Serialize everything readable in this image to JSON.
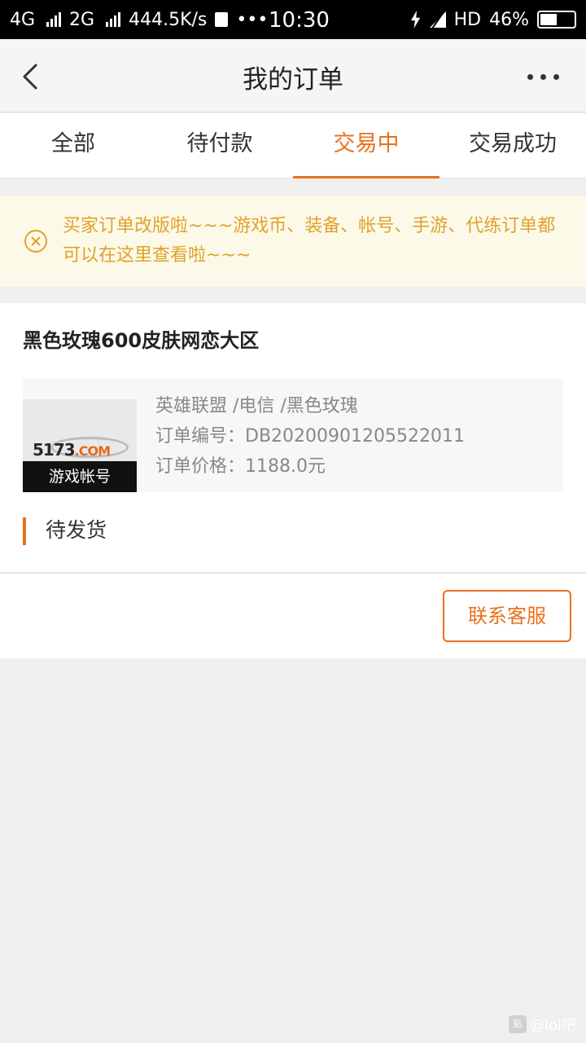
{
  "status_bar": {
    "network1": "4G",
    "network2": "2G",
    "speed": "444.5K/s",
    "dots": "•••",
    "time": "10:30",
    "hd": "HD",
    "battery": "46%"
  },
  "header": {
    "title": "我的订单"
  },
  "tabs": [
    {
      "label": "全部"
    },
    {
      "label": "待付款"
    },
    {
      "label": "交易中"
    },
    {
      "label": "交易成功"
    }
  ],
  "notice": {
    "text": "买家订单改版啦~~~游戏币、装备、帐号、手游、代练订单都可以在这里查看啦~~~"
  },
  "order": {
    "title": "黑色玫瑰600皮肤网恋大区",
    "thumb_logo": "5173",
    "thumb_logo_suffix": ".COM",
    "thumb_label": "游戏帐号",
    "game_info": "英雄联盟 /电信 /黑色玫瑰",
    "order_no": "订单编号：DB20200901205522011",
    "price": "订单价格：1188.0元",
    "status": "待发货",
    "contact_label": "联系客服"
  },
  "watermark": {
    "icon": "贴",
    "text": "@lol吧"
  },
  "colors": {
    "accent": "#e8711d",
    "notice_text": "#e0a22c",
    "notice_bg": "#fdf9e8"
  }
}
